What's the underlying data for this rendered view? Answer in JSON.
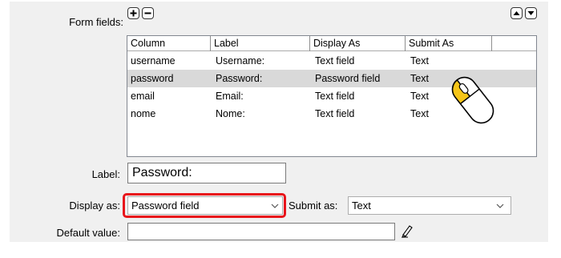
{
  "form_fields": {
    "label": "Form fields:",
    "add_icon": "plus-icon",
    "remove_icon": "minus-icon",
    "move_up_icon": "triangle-up-icon",
    "move_down_icon": "triangle-down-icon"
  },
  "table": {
    "columns": [
      "Column",
      "Label",
      "Display As",
      "Submit As"
    ],
    "rows": [
      {
        "column": "username",
        "label": "Username:",
        "display_as": "Text field",
        "submit_as": "Text",
        "selected": false
      },
      {
        "column": "password",
        "label": "Password:",
        "display_as": "Password field",
        "submit_as": "Text",
        "selected": true
      },
      {
        "column": "email",
        "label": "Email:",
        "display_as": "Text field",
        "submit_as": "Text",
        "selected": false
      },
      {
        "column": "nome",
        "label": "Nome:",
        "display_as": "Text field",
        "submit_as": "Text",
        "selected": false
      }
    ]
  },
  "label_field": {
    "label": "Label:",
    "value": "Password:"
  },
  "display_as": {
    "label": "Display as:",
    "value": "Password field"
  },
  "submit_as": {
    "label": "Submit as:",
    "value": "Text"
  },
  "default_value": {
    "label": "Default value:",
    "value": "",
    "browse_icon": "pencil-icon"
  },
  "colors": {
    "selected_row": "#d9d9d9",
    "highlight": "#e8141b",
    "mouse_button": "#f5c518"
  }
}
